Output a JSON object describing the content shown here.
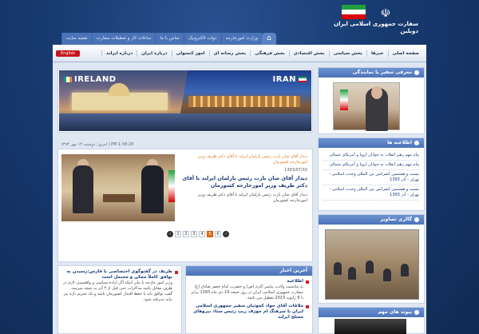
{
  "header": {
    "embassy_title_line1": "سفارت جمهوری اسلامی ایران",
    "embassy_title_line2": "دوبلین",
    "flag_colors": [
      "#239f40",
      "#ffffff",
      "#da0000"
    ]
  },
  "top_nav": {
    "home_icon": "home-icon",
    "items": [
      "وزارت امورخارجه",
      "دولت الکترونیک",
      "تماس با ما",
      "ساعات کار و تعطیلات سفارت",
      "نقشه سایت"
    ]
  },
  "main_nav": {
    "items": [
      "صفحه اصلی",
      "خبرها",
      "بخش سیاسی",
      "بخش اقتصادی",
      "بخش فرهنگی",
      "بخش رسانه ای",
      "امور کنسولی",
      "درباره ایران",
      "درباره ایرلند"
    ],
    "english_button": "English"
  },
  "banner": {
    "left_label": "IRELAND",
    "right_label": "IRAN"
  },
  "date_line": "امروز: دوشنبه ۱۴ مهر ۱۳۹۳ | PM 1:38:28",
  "featured_news": {
    "kicker": "دیدار آقای شان بارت رئیس پارلمان ایرلند با آقای دکتر ظریف وزیر امورخارجه کشورمان",
    "date": "1393/07/10",
    "title": "دیدار آقای شان بارت رئیس پارلمان ایرلند با آقای دکتر ظریف وزیر امورخارجه کشورمان",
    "summary": "دیدار آقای شان بارت رئیس پارلمان ایرلند با آقای دکتر ظریف وزیر امورخارجه کشورمان"
  },
  "pager": {
    "prev": "‹",
    "next": "›",
    "pages": [
      "1",
      "2",
      "3",
      "4",
      "5",
      "6"
    ],
    "active_page": "5"
  },
  "latest_news": {
    "title": "آخرین اخبار",
    "items": [
      {
        "title": "اطلاعیه",
        "text": "به مناسبت ولادت پیامبر اکرم (ص) و حضرت امام جعفر صادق (ع) سفارت جمهوری اسلامی ایران در روز جمعه 19 دی ماه 1393 برابر با 9 ژانویه 2015 تعطیل می باشد."
      },
      {
        "title": "ملاقات آقای جواد کچوئیان سفیر جمهوری اسلامی ایران با سرهنگ ام جوزف ریپ رئیس ستاد نیروهای مسلح ایرلند"
      }
    ]
  },
  "announcement": {
    "title": "ظریف در گفتوگوی اختصاصی با فارس:رسیدن به توافق کاملاً ممکن و محتمل است",
    "text": "وزیر امور خارجه با بیان اینکه اگر اراده سیاسی و واقعیبینی لازم در طرف مقابل باشد مذاکرات حتی قبل از ۴ آذر به نتیجه میرسد، گفت توافق باید با حفظ اقتدار کشورمان باشد و یک تحریم تازه نیز نباید پذیرفته شود."
  },
  "right_column": {
    "ambassador_heading": "معرفی سفیر یا نمایندگی",
    "info_heading": "اطلاعیه ها",
    "info_items": [
      "پیام مهم رهبر انقلاب به جوانان اروپا و آمریکای شمالی",
      "پیام مهم رهبر انقلاب به جوانان اروپا و آمریکای شمالی",
      "بیست و هشتمین کنفرانس بین المللی وحدت اسلامی - تهران - آذر 1393",
      "بیست و هشتمین کنفرانس بین المللی وحدت اسلامی - تهران - آذر 1393"
    ],
    "gallery_heading": "گالری تصاویر",
    "podcast_heading": "پیوند های مهم"
  }
}
